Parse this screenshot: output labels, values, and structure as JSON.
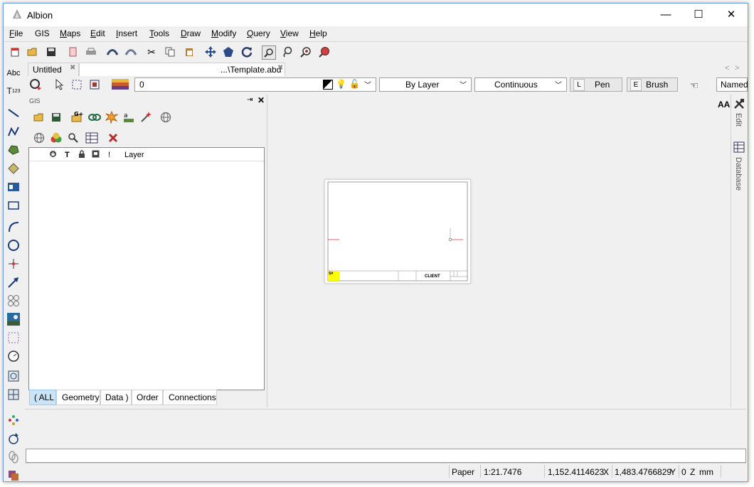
{
  "window": {
    "title": "Albion",
    "minimize": "—",
    "maximize": "☐",
    "close": "✕"
  },
  "menu": [
    {
      "u": "F",
      "rest": "ile"
    },
    {
      "u": "",
      "rest": "GIS"
    },
    {
      "u": "M",
      "rest": "aps"
    },
    {
      "u": "E",
      "rest": "dit"
    },
    {
      "u": "I",
      "rest": "nsert"
    },
    {
      "u": "T",
      "rest": "ools"
    },
    {
      "u": "D",
      "rest": "raw"
    },
    {
      "u": "M",
      "rest": "odify"
    },
    {
      "u": "Q",
      "rest": "uery"
    },
    {
      "u": "V",
      "rest": "iew"
    },
    {
      "u": "H",
      "rest": "elp"
    }
  ],
  "tabs": {
    "untitled": "Untitled",
    "template": "...\\Template.abd",
    "close_glyph": "✖",
    "nav_left": "<",
    "nav_right": ">"
  },
  "layerbar": {
    "layer_value": "0",
    "line_color": "By Layer",
    "line_type": "Continuous",
    "pen_key": "L",
    "pen_label": "Pen",
    "brush_key": "E",
    "brush_label": "Brush",
    "named": "Named"
  },
  "gis_panel": {
    "title": "GIS",
    "pin": "⇥",
    "close": "✕",
    "layer_header": "Layer",
    "col_t": "T",
    "col_excl": "!",
    "tabs": [
      "( ALL",
      "Geometry",
      "Data )",
      "Order",
      "Connections"
    ]
  },
  "canvas": {
    "aa_label": "AA",
    "titleblock_client": "CLIENT",
    "titleblock_code": "S#"
  },
  "right_tabs": {
    "edit": "Edit",
    "database": "Database"
  },
  "left_text_tools": {
    "abc": "Abc",
    "t": "T",
    "t_sub": "123"
  },
  "status": {
    "paper": "Paper",
    "scale": "1:21.7476",
    "x_value": "1,152.4114623",
    "x_label": "X",
    "y_value": "1,483.4766829",
    "y_label": "Y",
    "z_value": "0",
    "z_label": "Z",
    "units": "mm"
  },
  "colors": {
    "accent_tab": "#cce4f7",
    "window_border": "#6aa0d8",
    "titleblock_yellow": "#ffff00"
  }
}
